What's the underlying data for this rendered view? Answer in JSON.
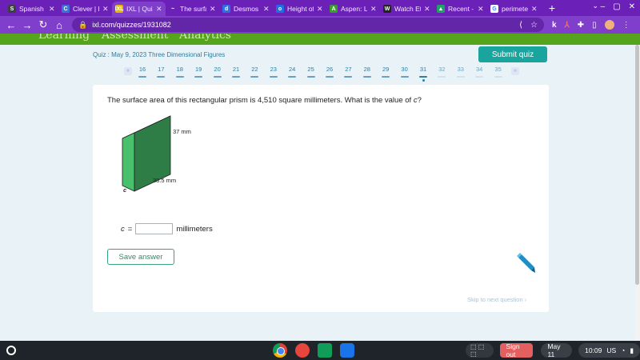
{
  "browser": {
    "tabs": [
      {
        "title": "Spanish",
        "color": "#3c4043",
        "icon": "S"
      },
      {
        "title": "Clever | P",
        "color": "#3b73d9",
        "icon": "C"
      },
      {
        "title": "IXL | Quiz",
        "color": "#e8b900",
        "icon": "IXL",
        "active": true
      },
      {
        "title": "The surfa",
        "color": "#6b20b8",
        "icon": "~"
      },
      {
        "title": "Desmos",
        "color": "#2f6fe4",
        "icon": "d"
      },
      {
        "title": "Height of",
        "color": "#1e6fe0",
        "icon": "o"
      },
      {
        "title": "Aspen: Le",
        "color": "#3b9b2f",
        "icon": "A"
      },
      {
        "title": "Watch Et",
        "color": "#222",
        "icon": "W"
      },
      {
        "title": "Recent - G",
        "color": "#1fa463",
        "icon": "▲"
      },
      {
        "title": "perimete",
        "color": "#fff",
        "icon": "G"
      }
    ],
    "new_tab": "+",
    "url": "ixl.com/quizzes/1931082"
  },
  "ixl_nav": {
    "items": [
      "Learning",
      "Assessment",
      "Analytics"
    ]
  },
  "quiz": {
    "title": "Quiz : May 9, 2023 Three Dimensional Figures",
    "submit_label": "Submit quiz",
    "question_numbers": [
      "16",
      "17",
      "18",
      "19",
      "20",
      "21",
      "22",
      "23",
      "24",
      "25",
      "26",
      "27",
      "28",
      "29",
      "30",
      "31",
      "32",
      "33",
      "34",
      "35"
    ],
    "current_question": "31"
  },
  "question": {
    "prompt_pre": "The surface area of this rectangular prism is 4,510 square millimeters. What is the value of ",
    "prompt_var": "c",
    "prompt_post": "?",
    "dim_height": "37 mm",
    "dim_width": "38.5 mm",
    "dim_var": "c",
    "answer_var": "c",
    "answer_eq": "=",
    "answer_value": "",
    "answer_unit": "millimeters",
    "save_label": "Save answer",
    "skip_label": "Skip to next question ›"
  },
  "shelf": {
    "tray_pill": "⬚ ⬚ ⬚",
    "signout": "Sign out",
    "date": "May 11",
    "time": "10:09",
    "locale": "US"
  },
  "colors": {
    "tab_bg": "#6b20b8",
    "ixl_green": "#56a41b",
    "submit_teal": "#19a59d",
    "prism_front": "#2e7d47",
    "prism_side": "#48c06c"
  }
}
